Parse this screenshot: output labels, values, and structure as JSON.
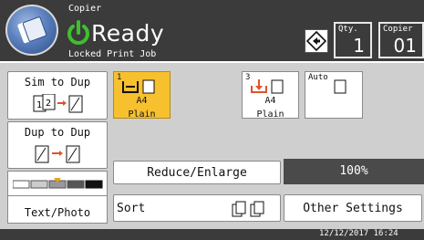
{
  "header": {
    "app_name": "Copier",
    "status": "Ready",
    "sub_status": "Locked Print Job",
    "qty_label": "Qty.",
    "qty_value": "1",
    "copier_label": "Copier",
    "copier_value": "01"
  },
  "left_buttons": {
    "sim_to_dup": "Sim to Dup",
    "dup_to_dup": "Dup to Dup",
    "text_photo": "Text/Photo"
  },
  "trays": [
    {
      "number": "1",
      "size": "A4",
      "type": "Plain",
      "selected": true
    },
    {
      "number": "3",
      "size": "A4",
      "type": "Plain",
      "selected": false
    },
    {
      "number": "",
      "label": "Auto",
      "selected": false
    }
  ],
  "bottom": {
    "reduce_enlarge": "Reduce/Enlarge",
    "percent": "100%",
    "sort": "Sort",
    "other_settings": "Other Settings"
  },
  "footer": {
    "datetime": "12/12/2017 16:24"
  },
  "colors": {
    "header_bg": "#3b3b3b",
    "selected_tray": "#f6c02f",
    "status_green": "#3fbf2f"
  }
}
